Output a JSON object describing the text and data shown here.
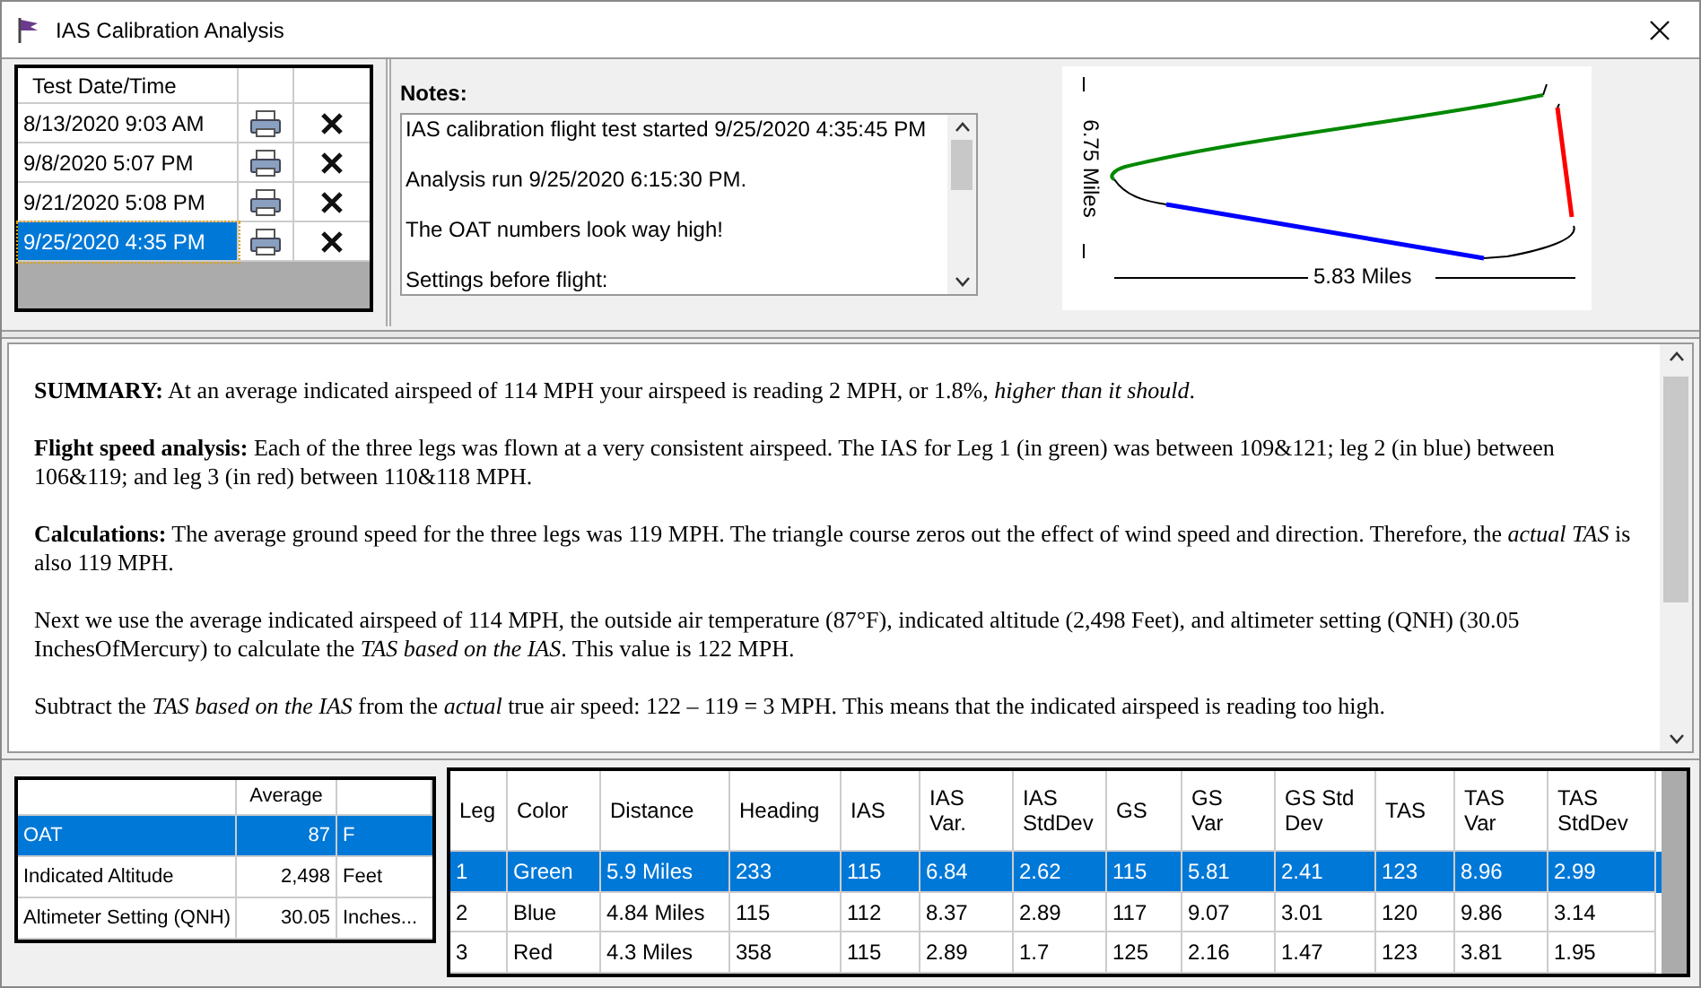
{
  "window": {
    "title": "IAS Calibration Analysis"
  },
  "tests": {
    "column": "Test Date/Time",
    "rows": [
      {
        "date": "8/13/2020 9:03 AM",
        "selected": false
      },
      {
        "date": "9/8/2020 5:07 PM",
        "selected": false
      },
      {
        "date": "9/21/2020 5:08 PM",
        "selected": false
      },
      {
        "date": "9/25/2020 4:35 PM",
        "selected": true
      }
    ]
  },
  "notes": {
    "label": "Notes:",
    "paragraphs": [
      "IAS calibration flight test started 9/25/2020 4:35:45 PM",
      "Analysis run 9/25/2020 6:15:30 PM.",
      "The OAT numbers look way high!",
      "Settings before flight:"
    ]
  },
  "plot": {
    "y_label": "6.75 Miles",
    "x_label": "5.83 Miles"
  },
  "summary": [
    "**SUMMARY:** At an average indicated airspeed of 114 MPH your airspeed is reading 2 MPH, or 1.8%, *higher than it should*.",
    "**Flight speed analysis:** Each of the three legs was flown at a very consistent airspeed. The IAS for Leg 1 (in green) was between 109&121; leg 2 (in blue) between 106&119; and leg 3 (in red) between 110&118 MPH.",
    "**Calculations:** The average ground speed for the three legs was 119 MPH. The triangle course zeros out the effect of wind speed and direction. Therefore, the *actual TAS* is also 119 MPH.",
    "Next we use the average indicated airspeed of 114 MPH, the outside air temperature (87°F), indicated altitude (2,498 Feet), and altimeter setting (QNH) (30.05 InchesOfMercury) to calculate the *TAS based on the IAS*. This value is 122 MPH.",
    "Subtract the *TAS based on the IAS* from the *actual* true air speed: 122 – 119 = 3 MPH. This means that the indicated airspeed is reading too high."
  ],
  "averages": {
    "columns": [
      "",
      "Average",
      ""
    ],
    "rows": [
      {
        "name": "OAT",
        "value": "87",
        "unit": "F",
        "selected": true
      },
      {
        "name": "Indicated Altitude",
        "value": "2,498",
        "unit": "Feet",
        "selected": false
      },
      {
        "name": "Altimeter Setting (QNH)",
        "value": "30.05",
        "unit": "Inches...",
        "selected": false
      }
    ]
  },
  "legs": {
    "columns": [
      "Leg",
      "Color",
      "Distance",
      "Heading",
      "IAS",
      "IAS\nVar.",
      "IAS\nStdDev",
      "GS",
      "GS\nVar",
      "GS Std\nDev",
      "TAS",
      "TAS\nVar",
      "TAS\nStdDev"
    ],
    "rows": [
      {
        "cells": [
          "1",
          "Green",
          "5.9 Miles",
          "233",
          "115",
          "6.84",
          "2.62",
          "115",
          "5.81",
          "2.41",
          "123",
          "8.96",
          "2.99"
        ],
        "selected": true
      },
      {
        "cells": [
          "2",
          "Blue",
          "4.84 Miles",
          "115",
          "112",
          "8.37",
          "2.89",
          "117",
          "9.07",
          "3.01",
          "120",
          "9.86",
          "3.14"
        ],
        "selected": false
      },
      {
        "cells": [
          "3",
          "Red",
          "4.3 Miles",
          "358",
          "115",
          "2.89",
          "1.7",
          "125",
          "2.16",
          "1.47",
          "123",
          "3.81",
          "1.95"
        ],
        "selected": false
      }
    ]
  }
}
